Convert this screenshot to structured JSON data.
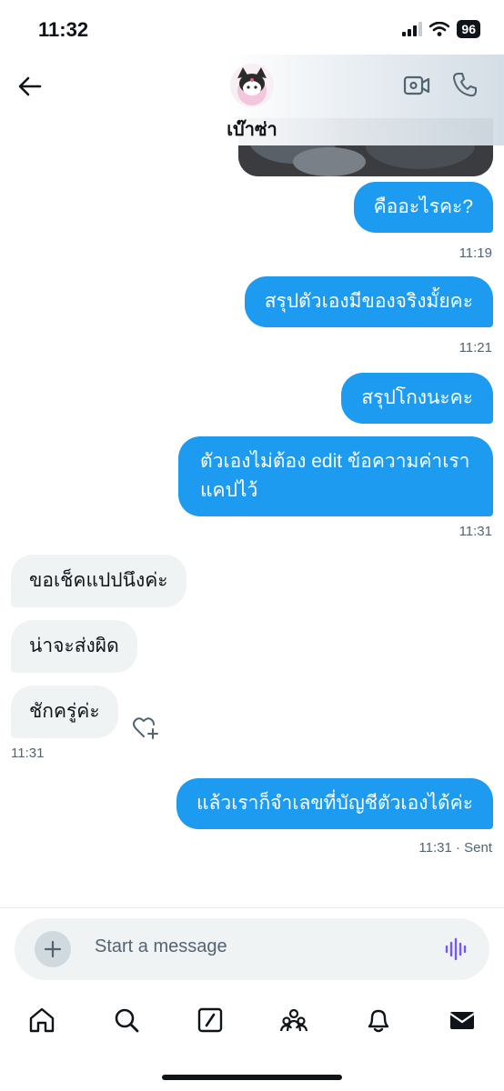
{
  "status_bar": {
    "time": "11:32",
    "battery": "96"
  },
  "header": {
    "name": "เบ๊าซ่า"
  },
  "messages": {
    "m1": "คืออะไรคะ?",
    "t1": "11:19",
    "m2": "สรุปตัวเองมีของจริงมั้ยคะ",
    "t2": "11:21",
    "m3": "สรุปโกงนะคะ",
    "m4_line1": "ตัวเองไม่ต้อง edit ข้อความค่าเรา",
    "m4_line2": "แคปไว้",
    "t4": "11:31",
    "r1": "ขอเช็คแปปนึงค่ะ",
    "r2": "น่าจะส่งผิด",
    "r3": "ชักครู่ค่ะ",
    "tr": "11:31",
    "m5": "แล้วเราก็จำเลขที่บัญชีตัวเองได้ค่ะ",
    "t5": "11:31 · Sent"
  },
  "composer": {
    "placeholder": "Start a message"
  },
  "colors": {
    "accent": "#1d9bf0",
    "incoming": "#eff3f4",
    "voice": "#7856ff"
  }
}
